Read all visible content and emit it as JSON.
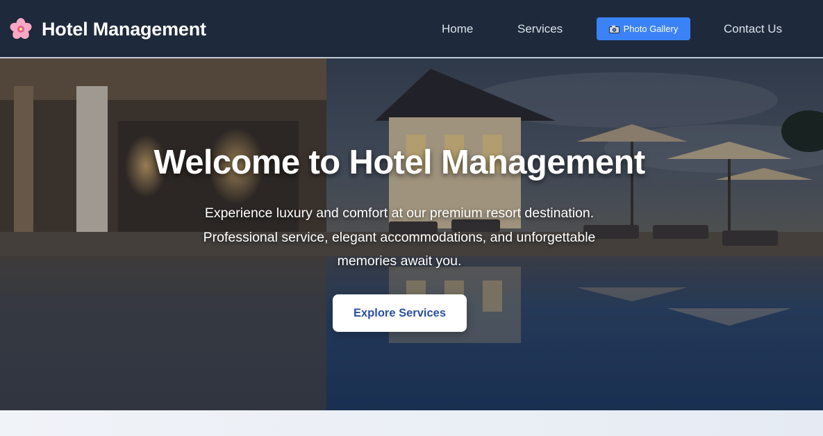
{
  "brand": {
    "icon": "cherry-blossom-icon",
    "title": "Hotel Management"
  },
  "nav": {
    "home": "Home",
    "services": "Services",
    "gallery": "Photo Gallery",
    "gallery_icon": "camera-icon",
    "contact": "Contact Us"
  },
  "hero": {
    "title": "Welcome to Hotel Management",
    "subtitle": "Experience luxury and comfort at our premium resort destination. Professional service, elegant accommodations, and unforgettable memories await you.",
    "cta": "Explore Services"
  },
  "colors": {
    "navbar": "#1e293b",
    "accent": "#3b82f6",
    "cta_text": "#2b4fa3"
  }
}
